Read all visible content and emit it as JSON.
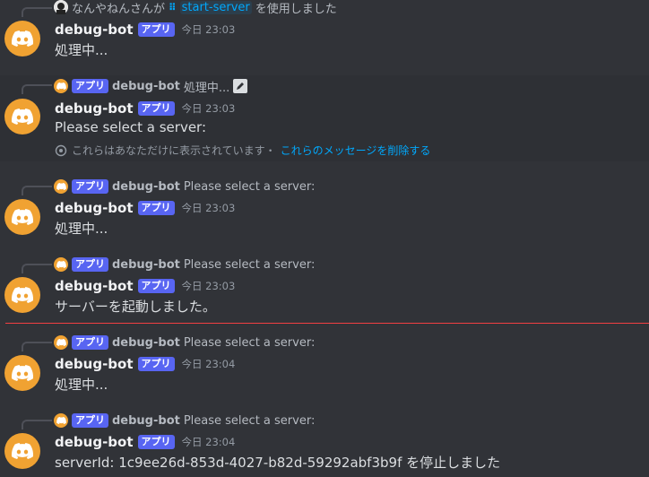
{
  "bot": {
    "name": "debug-bot",
    "badge": "アプリ"
  },
  "colors": {
    "background": "#313338",
    "highlight_background": "#2e3035",
    "avatar": "#f0a232",
    "badge": "#5865f2",
    "link": "#00a8fc",
    "new_divider": "#f23f43"
  },
  "messages": [
    {
      "reply": {
        "user": "なんやねんさんが",
        "command": "start-server",
        "suffix": "を使用しました"
      },
      "time": "今日 23:03",
      "content": "処理中..."
    },
    {
      "reply": {
        "preview": "処理中..."
      },
      "time": "今日 23:03",
      "content": "Please select a server:",
      "ephemeral": {
        "text": "これらはあなただけに表示されています・",
        "link": "これらのメッセージを削除する"
      }
    },
    {
      "reply": {
        "preview": "Please select a server:"
      },
      "time": "今日 23:03",
      "content": "処理中..."
    },
    {
      "reply": {
        "preview": "Please select a server:"
      },
      "time": "今日 23:03",
      "content": "サーバーを起動しました。"
    },
    {
      "reply": {
        "preview": "Please select a server:"
      },
      "time": "今日 23:04",
      "content": "処理中..."
    },
    {
      "reply": {
        "preview": "Please select a server:"
      },
      "time": "今日 23:04",
      "content": "serverId: 1c9ee26d-853d-4027-b82d-59292abf3b9f を停止しました"
    }
  ],
  "icons": {
    "bot_avatar": "discord-logo-icon",
    "command": "slash-command-icon",
    "pencil": "pencil-icon",
    "ephemeral": "eye-icon"
  }
}
